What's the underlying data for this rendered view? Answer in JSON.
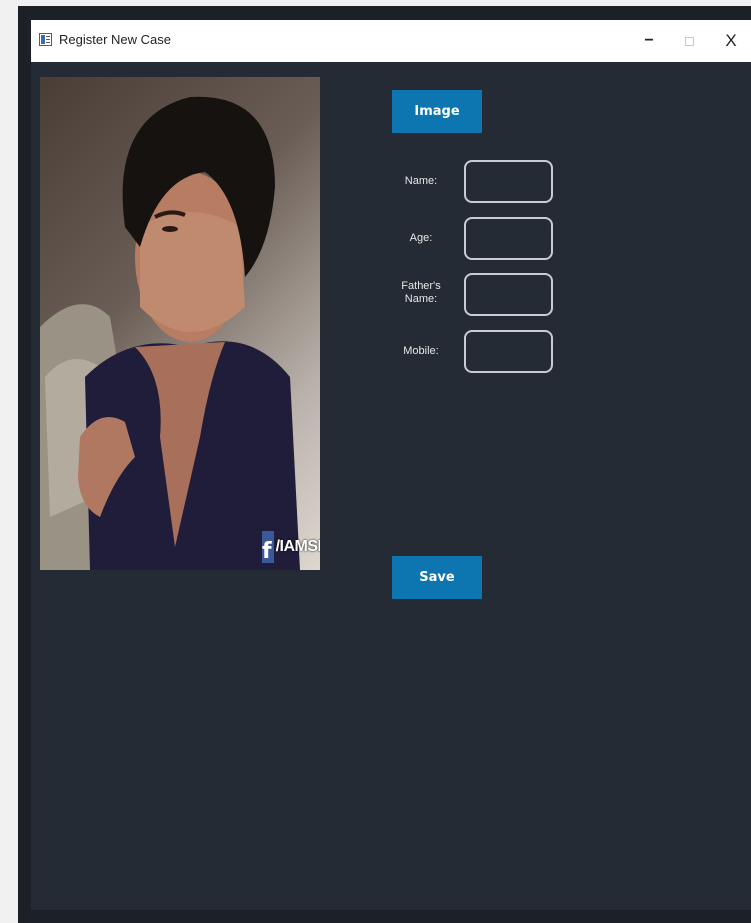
{
  "window": {
    "title": "Register New Case",
    "controls": {
      "minimize": "−",
      "close": "X"
    }
  },
  "photo": {
    "watermark_icon": "f",
    "watermark_text": "/IAMSR"
  },
  "buttons": {
    "image": "Image",
    "save": "Save"
  },
  "form": {
    "name": {
      "label": "Name:",
      "value": ""
    },
    "age": {
      "label": "Age:",
      "value": ""
    },
    "fathers_name": {
      "label": "Father's Name:",
      "value": ""
    },
    "mobile": {
      "label": "Mobile:",
      "value": ""
    }
  },
  "colors": {
    "background": "#252b34",
    "button": "#0d76b0",
    "input_border": "#c9ccd1"
  }
}
